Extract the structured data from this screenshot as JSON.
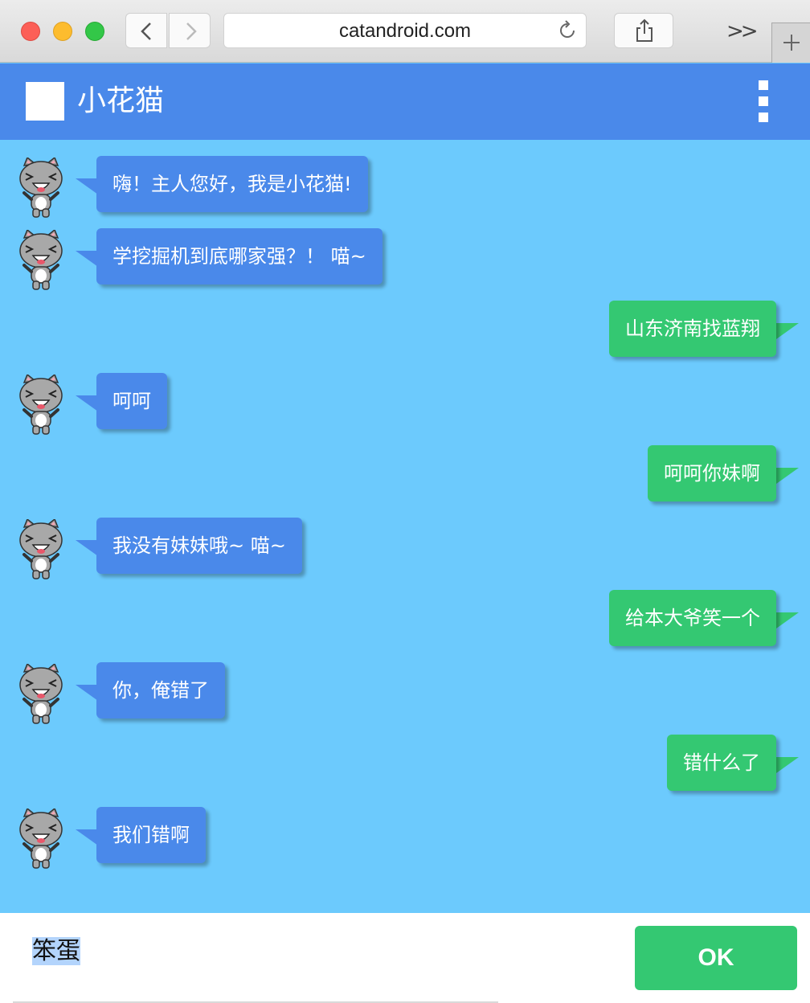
{
  "browser": {
    "url": "catandroid.com",
    "overflow_label": ">>"
  },
  "app": {
    "title": "小花猫"
  },
  "messages": [
    {
      "side": "left",
      "text": "嗨！主人您好，我是小花猫!"
    },
    {
      "side": "left",
      "text": "学挖掘机到底哪家强？！ 喵~"
    },
    {
      "side": "right",
      "text": "山东济南找蓝翔"
    },
    {
      "side": "left",
      "text": "呵呵"
    },
    {
      "side": "right",
      "text": "呵呵你妹啊"
    },
    {
      "side": "left",
      "text": "我没有妹妹哦~ 喵~"
    },
    {
      "side": "right",
      "text": "给本大爷笑一个"
    },
    {
      "side": "left",
      "text": "你，俺错了"
    },
    {
      "side": "right",
      "text": "错什么了"
    },
    {
      "side": "left",
      "text": "我们错啊"
    }
  ],
  "input": {
    "value": "笨蛋",
    "button_label": "OK"
  },
  "colors": {
    "header": "#4a89ea",
    "chat_background": "#6ccafd",
    "bot_bubble": "#4a89ea",
    "user_bubble": "#34c872"
  },
  "icons": {
    "avatar": "cat-avatar-icon",
    "menu": "vertical-dots-menu-icon"
  }
}
